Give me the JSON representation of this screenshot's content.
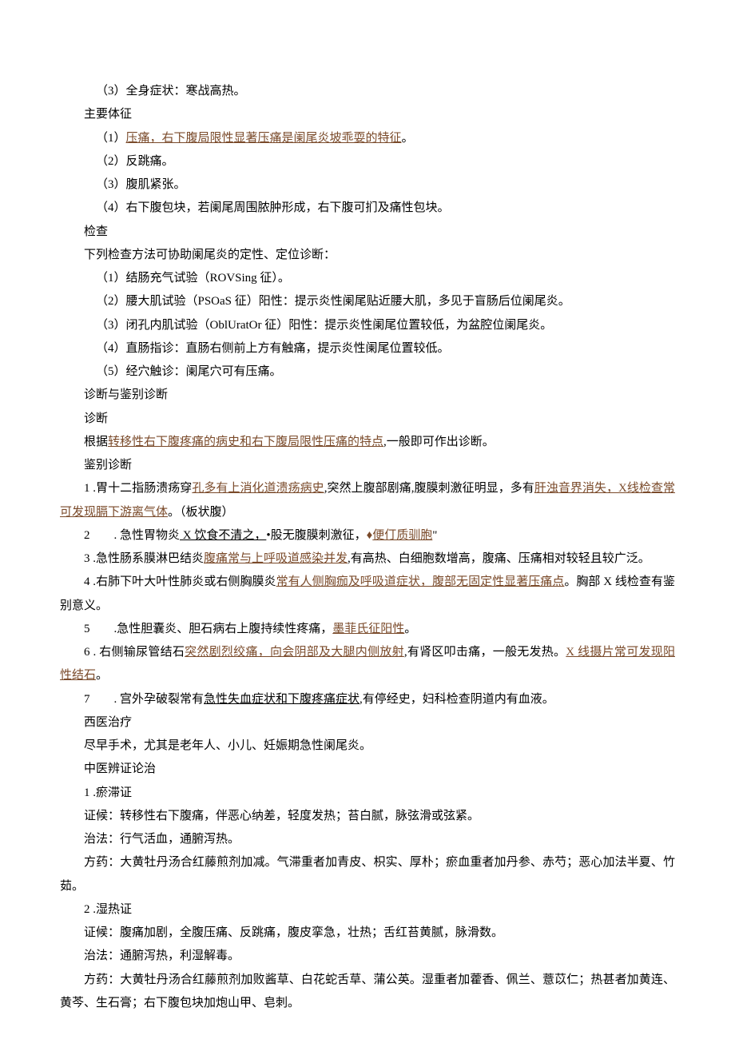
{
  "lines": {
    "l1": "（3）全身症状：寒战高热。",
    "l2": "主要体征",
    "l3_pre": "（1）",
    "l3_link": "压痛，右下腹局限性显著压痛是阑尾炎坡乖耍的特征",
    "l3_post": "。",
    "l4": "（2）反跳痛。",
    "l5": "（3）腹肌紧张。",
    "l6": "（4）右下腹包块，若阑尾周围脓肿形成，右下腹可扪及痛性包块。",
    "l7": "检查",
    "l8": "下列检查方法可协助阑尾炎的定性、定位诊断：",
    "l9": "（1）结肠充气试验（ROVSing 征）。",
    "l10": "（2）腰大肌试验（PSOaS 征）阳性：提示炎性阑尾贴近腰大肌，多见于盲肠后位阑尾炎。",
    "l11": "（3）闭孔内肌试验（OblUratOr 征）阳性：提示炎性阑尾位置较低，为盆腔位阑尾炎。",
    "l12": "（4）直肠指诊：直肠右侧前上方有触痛，提示炎性阑尾位置较低。",
    "l13": "（5）经穴触诊：阑尾穴可有压痛。",
    "l14": "诊断与鉴别诊断",
    "l15": "诊断",
    "l16_pre": "根据",
    "l16_link": "转移性右下腹疼痛的病史和右下腹局限性压痛的特点",
    "l16_post": ",一般即可作出诊断。",
    "l17": "鉴别诊断",
    "l18_pre": "1 .胃十二指肠溃疡穿",
    "l18_link1": "孔多有上消化道溃疡病史",
    "l18_mid": ",突然上腹部剧痛,腹膜刺激征明显，多有",
    "l18_link2": "肝浊",
    "l18b_link": "音界消失，X线检查常可发现膈下游离气体",
    "l18b_post": "。（板状腹）",
    "l19_pre": "2　　. 急性胃物炎",
    "l19_u1": " X 饮食不清之，",
    "l19_mid": "•股无腹膜刺激征，",
    "l19_diamond": "♦",
    "l19_link": "便仃质驯胞",
    "l19_post": "\"",
    "l20_pre": "3 .急性肠系膜淋巴结炎",
    "l20_link": "腹痛常与上呼吸道感染并发",
    "l20_post": ",有高热、白细胞数增高，腹痛、压痛相对较轻且较广泛。",
    "l21_pre": "4 .右肺下叶大叶性肺炎或右侧胸膜炎",
    "l21_link": "常有人侧胸痂及呼吸道症状，腹部无固定性显著压痛点",
    "l21_post": "。胸部 X 线检查有鉴别意义。",
    "l22_pre": "5　　.急性胆囊炎、胆石病右上腹持续性疼痛，",
    "l22_link": "墨菲氏征阳性",
    "l22_post": "。",
    "l23_pre": "6 . 右侧输尿管结石",
    "l23_link1": "突然剧烈绞痛，向会阴部及大腿内侧放射",
    "l23_mid": ",有肾区叩击痛，一般无发热。",
    "l23_link2": "X 线摄片常可发现阳性结石",
    "l23_post": "。",
    "l24_pre": "7　　. 宫外孕破裂常有",
    "l24_u": "急性失血症状和下腹疼痛症状",
    "l24_post": ",有停经史，妇科检查阴道内有血液。",
    "l25": "西医治疗",
    "l26": "尽早手术，尤其是老年人、小儿、妊娠期急性阑尾炎。",
    "l27": "中医辨证论治",
    "l28": "1 .瘀滞证",
    "l29": "证候：转移性右下腹痛，伴恶心纳差，轻度发热；苔白腻，脉弦滑或弦紧。",
    "l30": "治法：行气活血，通腑泻热。",
    "l31": "方药：大黄牡丹汤合红藤煎剂加减。气滞重者加青皮、枳实、厚朴；瘀血重者加丹参、赤芍；恶心加法半夏、竹茹。",
    "l32": "2 .湿热证",
    "l33": "证候：腹痛加剧，全腹压痛、反跳痛，腹皮挛急，壮热；舌红苔黄腻，脉滑数。",
    "l34": "治法：通腑泻热，利湿解毒。",
    "l35": "方药：大黄牡丹汤合红藤煎剂加败酱草、白花蛇舌草、蒲公英。湿重者加藿香、佩兰、薏苡仁；热甚者加黄连、黄芩、生石膏；右下腹包块加炮山甲、皂刺。"
  }
}
